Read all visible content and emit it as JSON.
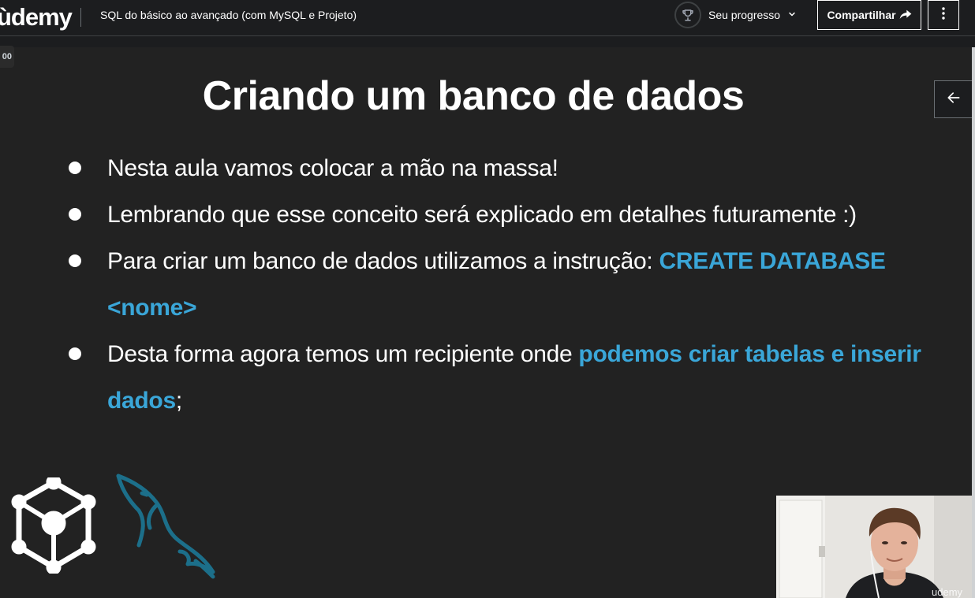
{
  "header": {
    "logo": "ùdemy",
    "course_title": "SQL do básico ao avançado (com MySQL e Projeto)",
    "progress_label": "Seu progresso",
    "share_label": "Compartilhar",
    "icons": [
      "trophy-icon",
      "chevron-down-icon",
      "share-arrow-icon",
      "more-vertical-icon"
    ]
  },
  "player": {
    "speed_badge": "00",
    "watermark": "udemy"
  },
  "slide": {
    "title": "Criando um banco de dados",
    "bullets": [
      {
        "parts": [
          {
            "text": "Nesta aula vamos colocar a mão na massa!"
          }
        ]
      },
      {
        "parts": [
          {
            "text": "Lembrando que esse conceito será explicado em detalhes futuramente :)"
          }
        ]
      },
      {
        "parts": [
          {
            "text": "Para criar um banco de dados utilizamos a instrução: "
          },
          {
            "text": "CREATE DATABASE <nome>",
            "highlight": true
          }
        ]
      },
      {
        "parts": [
          {
            "text": "Desta forma agora temos um recipiente onde "
          },
          {
            "text": "podemos criar tabelas e inserir dados",
            "highlight": true
          },
          {
            "text": ";"
          }
        ]
      }
    ],
    "highlight_color": "#3aa6d8"
  },
  "colors": {
    "background": "#1c1d1f",
    "slide_background": "#222222",
    "text": "#ffffff",
    "dolphin": "#1c6f8a"
  }
}
